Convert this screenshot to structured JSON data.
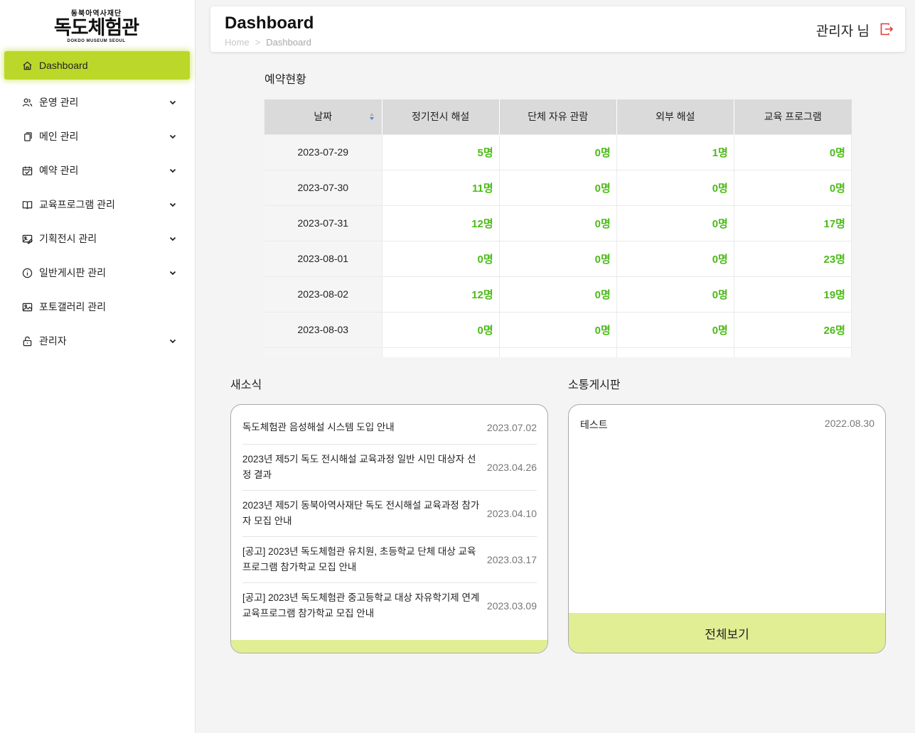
{
  "logo": {
    "top": "동북아역사재단",
    "main": "독도체험관",
    "sub": "DOKDO MUSEUM SEOUL"
  },
  "sidebar": {
    "items": [
      {
        "label": "Dashboard",
        "icon": "home-icon",
        "active": true
      },
      {
        "label": "운영 관리",
        "icon": "users-icon",
        "has_children": true
      },
      {
        "label": "메인 관리",
        "icon": "copy-icon",
        "has_children": true
      },
      {
        "label": "예약 관리",
        "icon": "calendar-icon",
        "has_children": true
      },
      {
        "label": "교육프로그램 관리",
        "icon": "book-icon",
        "has_children": true
      },
      {
        "label": "기획전시 관리",
        "icon": "gallery-edit-icon",
        "has_children": true
      },
      {
        "label": "일반게시판 관리",
        "icon": "info-icon",
        "has_children": true
      },
      {
        "label": "포토갤러리 관리",
        "icon": "image-icon",
        "has_children": false
      },
      {
        "label": "관리자",
        "icon": "lock-icon",
        "has_children": true
      }
    ]
  },
  "header": {
    "title": "Dashboard",
    "breadcrumb_home": "Home",
    "breadcrumb_sep": ">",
    "breadcrumb_current": "Dashboard",
    "user": "관리자 님"
  },
  "reservation": {
    "title": "예약현황",
    "columns": [
      "날짜",
      "정기전시 해설",
      "단체 자유 관람",
      "외부 해설",
      "교육 프로그램"
    ],
    "rows": [
      [
        "2023-07-29",
        "5명",
        "0명",
        "1명",
        "0명"
      ],
      [
        "2023-07-30",
        "11명",
        "0명",
        "0명",
        "0명"
      ],
      [
        "2023-07-31",
        "12명",
        "0명",
        "0명",
        "17명"
      ],
      [
        "2023-08-01",
        "0명",
        "0명",
        "0명",
        "23명"
      ],
      [
        "2023-08-02",
        "12명",
        "0명",
        "0명",
        "19명"
      ],
      [
        "2023-08-03",
        "0명",
        "0명",
        "0명",
        "26명"
      ]
    ]
  },
  "news": {
    "title": "새소식",
    "items": [
      {
        "title": "독도체험관 음성해설 시스템 도입 안내",
        "date": "2023.07.02"
      },
      {
        "title": "2023년 제5기 독도 전시해설 교육과정 일반 시민 대상자 선정 결과",
        "date": "2023.04.26"
      },
      {
        "title": "2023년 제5기 동북아역사재단 독도 전시해설 교육과정 참가자 모집 안내",
        "date": "2023.04.10"
      },
      {
        "title": "[공고] 2023년 독도체험관 유치원, 초등학교 단체 대상 교육프로그램 참가학교 모집 안내",
        "date": "2023.03.17"
      },
      {
        "title": "[공고] 2023년 독도체험관 중고등학교 대상 자유학기제 연계 교육프로그램 참가학교 모집 안내",
        "date": "2023.03.09"
      }
    ]
  },
  "board": {
    "title": "소통게시판",
    "items": [
      {
        "title": "테스트",
        "date": "2022.08.30"
      }
    ],
    "view_all": "전체보기"
  },
  "colors": {
    "accent": "#bbd82a",
    "accent_light": "#e2ee94",
    "number_green": "#4cbb17",
    "logout_red": "#e53935"
  }
}
